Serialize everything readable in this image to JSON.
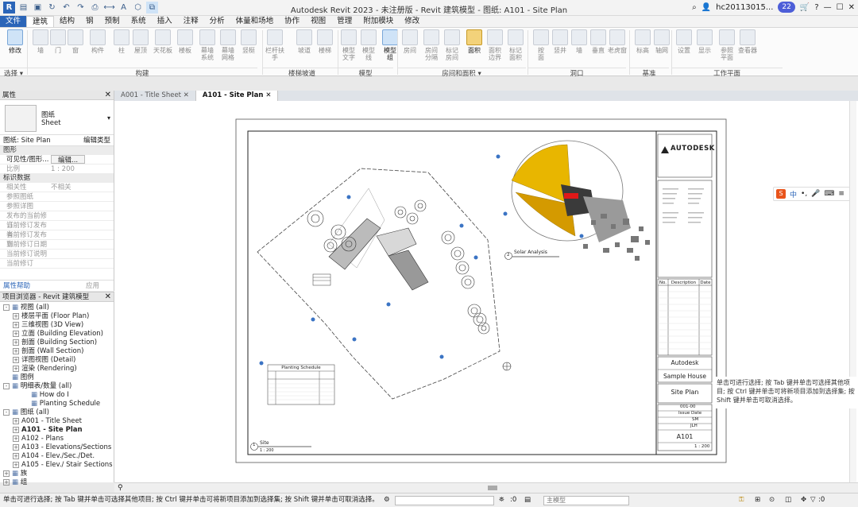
{
  "titlebar": {
    "title": "Autodesk Revit 2023 - 未注册版 - Revit 建筑模型 - 图纸: A101 - Site Plan",
    "user": "hc20113015...",
    "notifications": "22"
  },
  "menu": [
    "文件",
    "建筑",
    "结构",
    "钢",
    "预制",
    "系统",
    "插入",
    "注释",
    "分析",
    "体量和场地",
    "协作",
    "视图",
    "管理",
    "附加模块",
    "修改"
  ],
  "ribbon": {
    "buttons": [
      {
        "label": "修改",
        "on": true
      },
      {
        "label": "墙"
      },
      {
        "label": "门"
      },
      {
        "label": "窗"
      },
      {
        "label": "构件"
      },
      {
        "label": "柱"
      },
      {
        "label": "屋顶"
      },
      {
        "label": "天花板"
      },
      {
        "label": "楼板"
      },
      {
        "label": "幕墙\n系统"
      },
      {
        "label": "幕墙\n网格"
      },
      {
        "label": "竖梃"
      },
      {
        "label": "栏杆扶手"
      },
      {
        "label": "坡道"
      },
      {
        "label": "楼梯"
      },
      {
        "label": "模型\n文字"
      },
      {
        "label": "模型\n线"
      },
      {
        "label": "模型\n组",
        "on": true
      },
      {
        "label": "房间"
      },
      {
        "label": "房间\n分隔"
      },
      {
        "label": "标记\n房间"
      },
      {
        "label": "面积",
        "on": true
      },
      {
        "label": "面积\n边界"
      },
      {
        "label": "标记\n面积"
      },
      {
        "label": "按\n面"
      },
      {
        "label": "竖井"
      },
      {
        "label": "墙"
      },
      {
        "label": "垂直"
      },
      {
        "label": "老虎窗"
      },
      {
        "label": "标高"
      },
      {
        "label": "轴网"
      },
      {
        "label": "设置"
      },
      {
        "label": "显示"
      },
      {
        "label": "参照\n平面"
      },
      {
        "label": "查看器"
      }
    ],
    "groups": [
      "选择 ▾",
      "构建",
      "楼梯坡道",
      "模型",
      "房间和面积 ▾",
      "洞口",
      "基准",
      "工作平面"
    ]
  },
  "properties": {
    "header": "属性",
    "type_name": "图纸",
    "type_sub": "Sheet",
    "selector": "图纸: Site Plan",
    "edit_type": "编辑类型",
    "sections": [
      {
        "name": "图形",
        "rows": [
          [
            "可见性/图形...",
            "编辑..."
          ],
          [
            "比例",
            "1 : 200"
          ]
        ]
      },
      {
        "name": "标识数据",
        "rows": [
          [
            "相关性",
            "不相关"
          ],
          [
            "参照图纸",
            ""
          ],
          [
            "参照详图",
            ""
          ],
          [
            "发布的当前修订",
            ""
          ],
          [
            "当前修订发布者",
            ""
          ],
          [
            "当前修订发布到",
            ""
          ],
          [
            "当前修订日期",
            ""
          ],
          [
            "当前修订说明",
            ""
          ],
          [
            "当前修订",
            ""
          ]
        ]
      }
    ],
    "help": "属性帮助",
    "apply": "应用"
  },
  "browser": {
    "header": "项目浏览器 - Revit 建筑模型",
    "nodes": [
      {
        "t": "视图 (all)",
        "lvl": 0,
        "pm": "-"
      },
      {
        "t": "楼层平面 (Floor Plan)",
        "lvl": 1,
        "pm": "+"
      },
      {
        "t": "三维视图 (3D View)",
        "lvl": 1,
        "pm": "+"
      },
      {
        "t": "立面 (Building Elevation)",
        "lvl": 1,
        "pm": "+"
      },
      {
        "t": "剖面 (Building Section)",
        "lvl": 1,
        "pm": "+"
      },
      {
        "t": "剖面 (Wall Section)",
        "lvl": 1,
        "pm": "+"
      },
      {
        "t": "详图视图 (Detail)",
        "lvl": 1,
        "pm": "+"
      },
      {
        "t": "渲染 (Rendering)",
        "lvl": 1,
        "pm": "+"
      },
      {
        "t": "图例",
        "lvl": 0,
        "pm": ""
      },
      {
        "t": "明细表/数量 (all)",
        "lvl": 0,
        "pm": "-"
      },
      {
        "t": "How do I",
        "lvl": 2,
        "pm": ""
      },
      {
        "t": "Planting Schedule",
        "lvl": 2,
        "pm": ""
      },
      {
        "t": "图纸 (all)",
        "lvl": 0,
        "pm": "-"
      },
      {
        "t": "A001 - Title Sheet",
        "lvl": 1,
        "pm": "+"
      },
      {
        "t": "A101 - Site Plan",
        "lvl": 1,
        "pm": "+",
        "bold": true
      },
      {
        "t": "A102 - Plans",
        "lvl": 1,
        "pm": "+"
      },
      {
        "t": "A103 - Elevations/Sections",
        "lvl": 1,
        "pm": "+"
      },
      {
        "t": "A104 - Elev./Sec./Det.",
        "lvl": 1,
        "pm": "+"
      },
      {
        "t": "A105 - Elev./ Stair Sections",
        "lvl": 1,
        "pm": "+"
      },
      {
        "t": "族",
        "lvl": 0,
        "pm": "+"
      },
      {
        "t": "组",
        "lvl": 0,
        "pm": "+"
      }
    ]
  },
  "doctabs": [
    "A001 - Title Sheet",
    "A101 - Site Plan"
  ],
  "sheet": {
    "logo": "AUTODESK",
    "company": "Autodesk",
    "project": "Sample House",
    "sheet_name": "Site Plan",
    "sheet_number": "A101",
    "scale": "1 : 200",
    "project_number": "001-00",
    "date": "Issue Date",
    "drawn_by": "SM",
    "checked_by": "JLH",
    "rev_headers": [
      "No.",
      "Description",
      "Date"
    ],
    "view1_num": "1",
    "view1_title": "Site",
    "view1_scale": "1 : 200",
    "view2_num": "2",
    "view2_title": "Solar Analysis",
    "schedule_title": "Planting Schedule"
  },
  "tooltip": "单击可进行选择; 按 Tab 键并单击可选择其他项目; 按 Ctrl 键并单击可将新项目添加到选择集; 按 Shift 键并单击可取消选择。",
  "status": {
    "text": "单击可进行选择; 按 Tab 键并单击可选择其他项目; 按 Ctrl 键并单击可将新项目添加到选择集; 按 Shift 键并单击可取消选择。",
    "zero": ":0",
    "model": "主模型",
    "filter": ":0"
  }
}
